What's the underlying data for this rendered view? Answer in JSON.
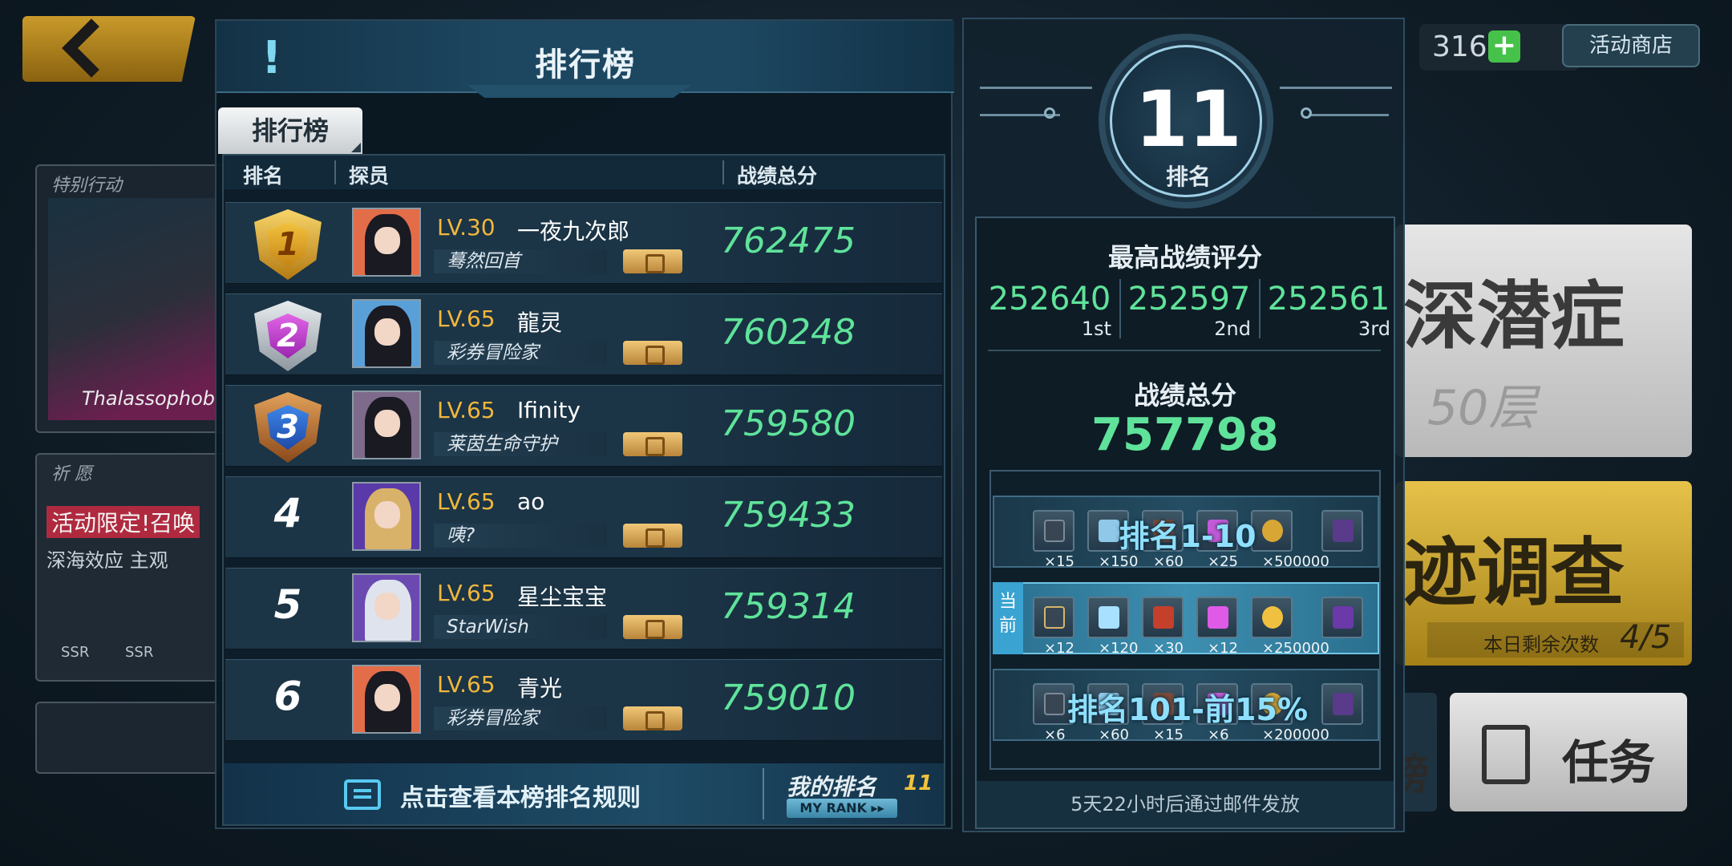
{
  "hud": {
    "currency_value": "316",
    "shop_label": "活动商店"
  },
  "background": {
    "card1_tag": "特别行动",
    "card1_caption": "Thalassophob",
    "card2_tag": "祈 愿",
    "card2_line1": "活动限定!召唤",
    "card2_line2": "深海效应  主观",
    "card2_badge": "SSR",
    "right1_title": "深潜症",
    "right1_sub": "50层",
    "right2_title": "迹调查",
    "right2_remain_label": "本日剩余次数",
    "right2_remain_value": "4/5",
    "right3_label": "任务",
    "right4_label": "榜"
  },
  "leaderboard": {
    "title": "排行榜",
    "tab_label": "排行榜",
    "col_rank": "排名",
    "col_agent": "探员",
    "col_score": "战绩总分",
    "rows": [
      {
        "rank": "1",
        "level": "LV.30",
        "name": "一夜九次郎",
        "title": "蓦然回首",
        "score": "762475"
      },
      {
        "rank": "2",
        "level": "LV.65",
        "name": "龍灵",
        "title": "彩券冒险家",
        "score": "760248"
      },
      {
        "rank": "3",
        "level": "LV.65",
        "name": "Ifinity",
        "title": "莱茵生命守护",
        "score": "759580"
      },
      {
        "rank": "4",
        "level": "LV.65",
        "name": "ao",
        "title": "咦?",
        "score": "759433"
      },
      {
        "rank": "5",
        "level": "LV.65",
        "name": "星尘宝宝",
        "title": "StarWish",
        "score": "759314"
      },
      {
        "rank": "6",
        "level": "LV.65",
        "name": "青光",
        "title": "彩券冒险家",
        "score": "759010"
      }
    ],
    "rules_label": "点击查看本榜排名规则",
    "my_rank_label": "我的排名",
    "my_rank_value": "11",
    "my_rank_button": "MY RANK ▸▸"
  },
  "summary": {
    "rank_value": "11",
    "rank_label": "排名",
    "best_label": "最高战绩评分",
    "best": [
      {
        "value": "252640",
        "ord": "1st"
      },
      {
        "value": "252597",
        "ord": "2nd"
      },
      {
        "value": "252561",
        "ord": "3rd"
      }
    ],
    "total_label": "战绩总分",
    "total_value": "757798",
    "current_tag": "当前",
    "tiers": [
      {
        "name": "排名1-10",
        "items": [
          "×15",
          "×150",
          "×60",
          "×25",
          "×500000",
          ""
        ]
      },
      {
        "name": "",
        "items": [
          "×12",
          "×120",
          "×30",
          "×12",
          "×250000",
          ""
        ]
      },
      {
        "name": "排名101-前15%",
        "items": [
          "×6",
          "×60",
          "×15",
          "×6",
          "×200000",
          ""
        ]
      }
    ],
    "mail_note": "5天22小时后通过邮件发放"
  },
  "colors": {
    "score_green": "#5fe39a",
    "level_gold": "#f1b73b",
    "accent_blue": "#3aa3d1"
  }
}
